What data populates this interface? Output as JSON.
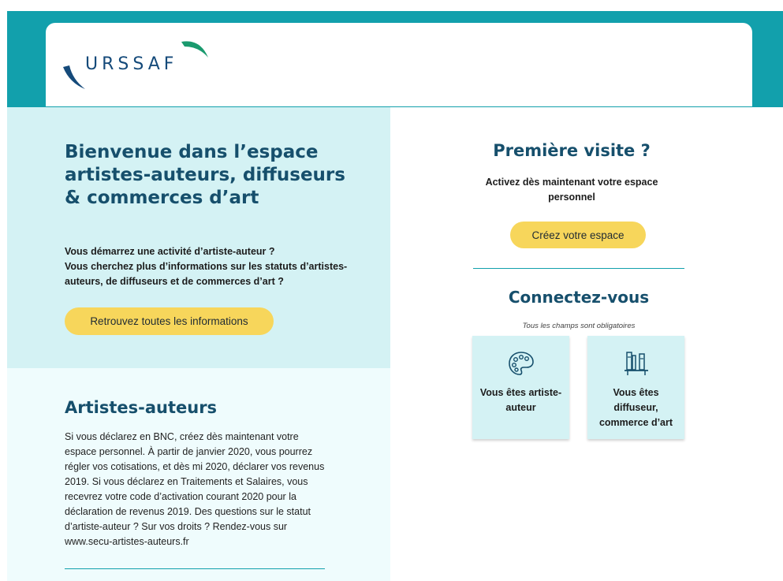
{
  "header": {
    "logo_text": "URSSAF"
  },
  "welcome": {
    "title": "Bienvenue dans l’espace artistes-auteurs, diffuseurs & commerces d’art",
    "line1": "Vous démarrez une activité d’artiste-auteur ?",
    "line2": "Vous cherchez plus d’informations sur les statuts d’artistes-auteurs, de diffuseurs et de commerces d’art ?",
    "button_label": "Retrouvez toutes les informations"
  },
  "artists": {
    "title": "Artistes-auteurs",
    "text": "Si vous déclarez en BNC, créez dès maintenant votre espace personnel. À partir de janvier 2020, vous pourrez régler vos cotisations, et dès mi 2020, déclarer vos revenus 2019. Si vous déclarez en Traitements et Salaires, vous recevrez votre code d’activation courant 2020 pour la déclaration de revenus 2019. Des questions sur le statut d’artiste-auteur ? Sur vos droits ? Rendez-vous sur www.secu-artistes-auteurs.fr"
  },
  "first_visit": {
    "title": "Première visite ?",
    "subtitle": "Activez dès maintenant votre espace personnel",
    "button_label": "Créez votre espace"
  },
  "connect": {
    "title": "Connectez-vous",
    "required_note": "Tous les champs sont obligatoires",
    "tiles": [
      {
        "label": "Vous êtes artiste-auteur",
        "icon": "palette-icon"
      },
      {
        "label": "Vous êtes diffuseur, commerce d’art",
        "icon": "bookshelf-icon"
      }
    ]
  },
  "colors": {
    "teal_band": "#12a0ac",
    "panel_light": "#d4f2f4",
    "panel_lighter": "#effcfd",
    "heading": "#164f6c",
    "button_yellow": "#f7d65b",
    "logo_blue": "#154a7a",
    "logo_green": "#1a9a6e"
  }
}
